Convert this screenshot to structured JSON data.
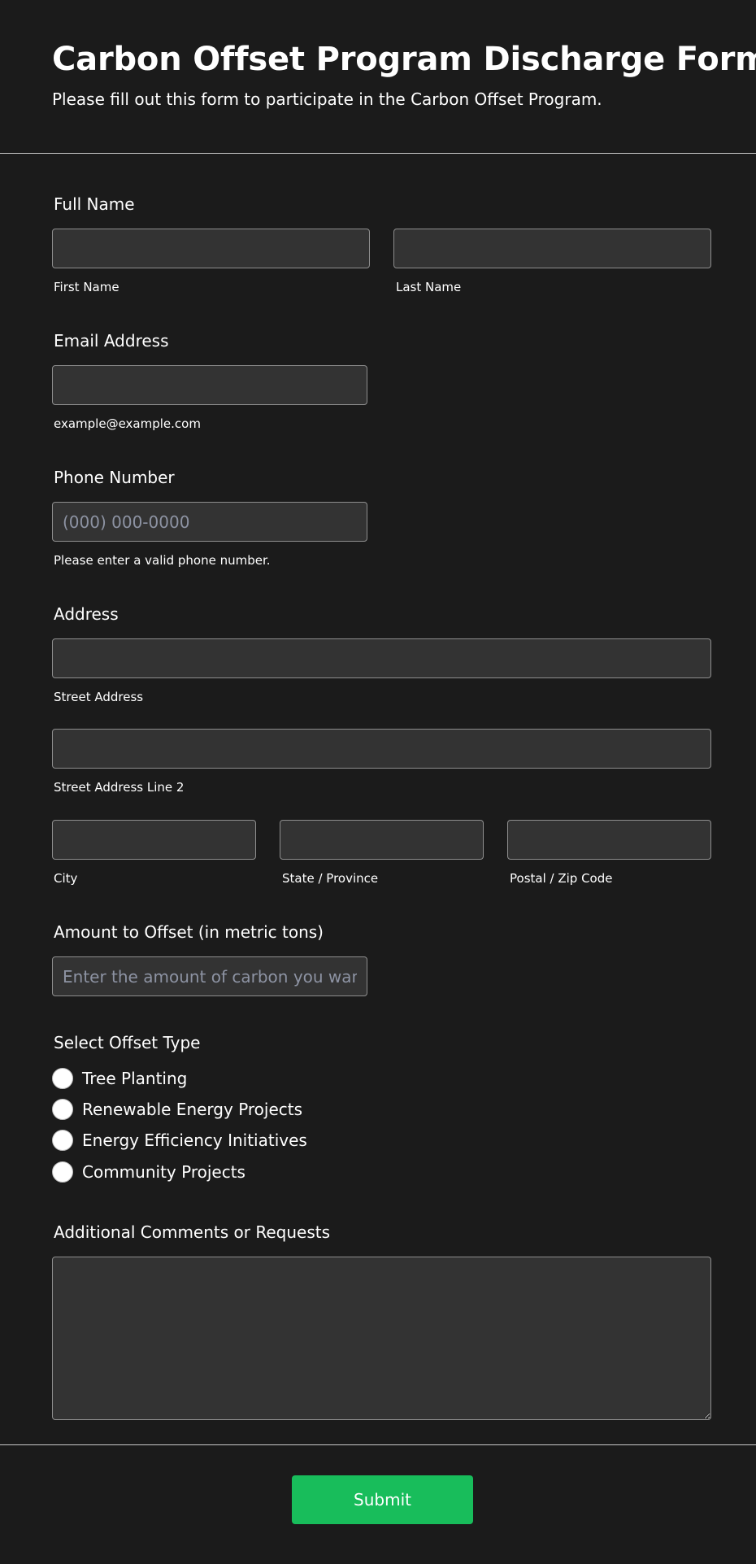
{
  "header": {
    "title": "Carbon Offset Program Discharge Form",
    "subtitle": "Please fill out this form to participate in the Carbon Offset Program."
  },
  "full_name": {
    "label": "Full Name",
    "first": {
      "value": "",
      "sublabel": "First Name"
    },
    "last": {
      "value": "",
      "sublabel": "Last Name"
    }
  },
  "email": {
    "label": "Email Address",
    "value": "",
    "sublabel": "example@example.com"
  },
  "phone": {
    "label": "Phone Number",
    "value": "",
    "placeholder": "(000) 000-0000",
    "sublabel": "Please enter a valid phone number."
  },
  "address": {
    "label": "Address",
    "street": {
      "value": "",
      "sublabel": "Street Address"
    },
    "street2": {
      "value": "",
      "sublabel": "Street Address Line 2"
    },
    "city": {
      "value": "",
      "sublabel": "City"
    },
    "state": {
      "value": "",
      "sublabel": "State / Province"
    },
    "postal": {
      "value": "",
      "sublabel": "Postal / Zip Code"
    }
  },
  "amount": {
    "label": "Amount to Offset (in metric tons)",
    "value": "",
    "placeholder": "Enter the amount of carbon you want to offset"
  },
  "offset_type": {
    "label": "Select Offset Type",
    "options": [
      {
        "label": "Tree Planting",
        "selected": false
      },
      {
        "label": "Renewable Energy Projects",
        "selected": false
      },
      {
        "label": "Energy Efficiency Initiatives",
        "selected": false
      },
      {
        "label": "Community Projects",
        "selected": false
      }
    ]
  },
  "comments": {
    "label": "Additional Comments or Requests",
    "value": ""
  },
  "submit": {
    "label": "Submit"
  },
  "colors": {
    "background": "#1b1b1b",
    "input_background": "#333333",
    "input_border": "#8e8e8e",
    "divider": "#c9c9c9",
    "accent": "#18bd5b",
    "text": "#ffffff",
    "placeholder": "#8d93a3"
  }
}
